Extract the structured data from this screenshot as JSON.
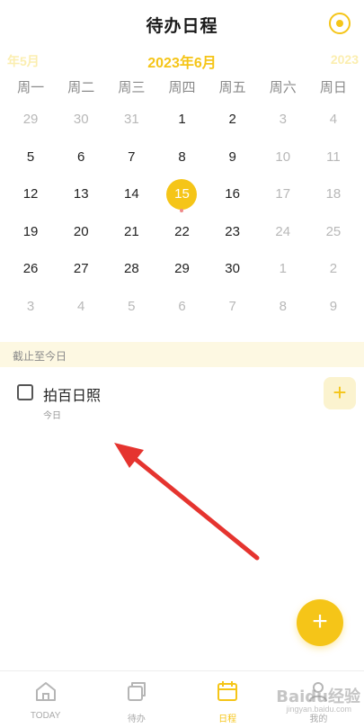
{
  "header": {
    "title": "待办日程"
  },
  "calendar": {
    "prev_month": "年5月",
    "current_month": "2023年6月",
    "next_month": "2023",
    "weekdays": [
      "周一",
      "周二",
      "周三",
      "周四",
      "周五",
      "周六",
      "周日"
    ],
    "weeks": [
      [
        [
          "29",
          true
        ],
        [
          "30",
          true
        ],
        [
          "31",
          true
        ],
        [
          "1",
          false
        ],
        [
          "2",
          false
        ],
        [
          "3",
          true
        ],
        [
          "4",
          true
        ]
      ],
      [
        [
          "5",
          false
        ],
        [
          "6",
          false
        ],
        [
          "7",
          false
        ],
        [
          "8",
          false
        ],
        [
          "9",
          false
        ],
        [
          "10",
          true
        ],
        [
          "11",
          true
        ]
      ],
      [
        [
          "12",
          false
        ],
        [
          "13",
          false
        ],
        [
          "14",
          false
        ],
        [
          "15",
          false
        ],
        [
          "16",
          false
        ],
        [
          "17",
          true
        ],
        [
          "18",
          true
        ]
      ],
      [
        [
          "19",
          false
        ],
        [
          "20",
          false
        ],
        [
          "21",
          false
        ],
        [
          "22",
          false
        ],
        [
          "23",
          false
        ],
        [
          "24",
          true
        ],
        [
          "25",
          true
        ]
      ],
      [
        [
          "26",
          false
        ],
        [
          "27",
          false
        ],
        [
          "28",
          false
        ],
        [
          "29",
          false
        ],
        [
          "30",
          false
        ],
        [
          "1",
          true
        ],
        [
          "2",
          true
        ]
      ],
      [
        [
          "3",
          true
        ],
        [
          "4",
          true
        ],
        [
          "5",
          true
        ],
        [
          "6",
          true
        ],
        [
          "7",
          true
        ],
        [
          "8",
          true
        ],
        [
          "9",
          true
        ]
      ]
    ],
    "selected_day": "15",
    "colors": {
      "accent": "#f5c518",
      "muted": "#b8b8b8",
      "event_dot": "#ef8a8a"
    }
  },
  "section": {
    "label": "截止至今日"
  },
  "tasks": [
    {
      "name": "拍百日照",
      "due": "今日",
      "add_label": "+"
    }
  ],
  "fab": {
    "label": "+"
  },
  "tabbar": {
    "items": [
      {
        "label": "TODAY",
        "icon": "home-icon",
        "active": false
      },
      {
        "label": "待办",
        "icon": "stack-icon",
        "active": false
      },
      {
        "label": "日程",
        "icon": "calendar-icon",
        "active": true
      },
      {
        "label": "我的",
        "icon": "person-icon",
        "active": false
      }
    ]
  },
  "watermark": {
    "text": "Baidu经验",
    "sub": "jingyan.baidu.com"
  }
}
